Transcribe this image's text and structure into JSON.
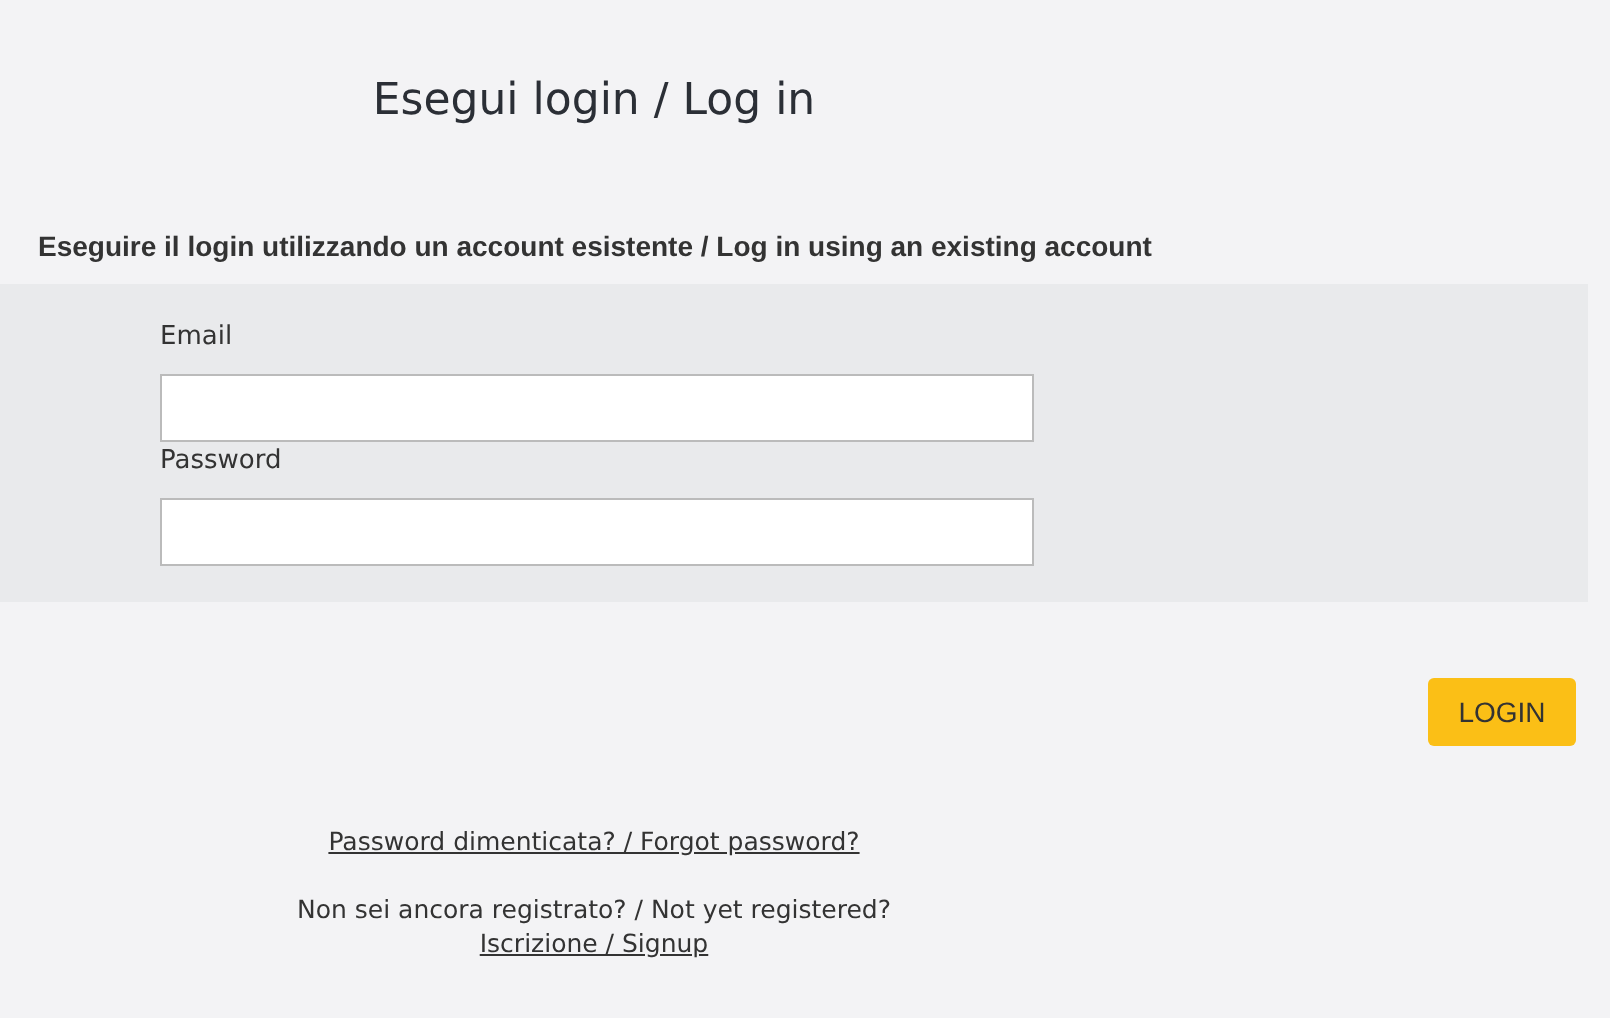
{
  "title": "Esegui login / Log in",
  "subtitle": "Eseguire il login utilizzando un account esistente / Log in using an existing account",
  "fields": [
    {
      "label": "Email"
    },
    {
      "label": "Password"
    }
  ],
  "login_button": "LOGIN",
  "forgot_link": "Password dimenticata? / Forgot password?",
  "register_prompt": "Non sei ancora registrato? / Not yet registered?",
  "signup_link": "Iscrizione / Signup"
}
